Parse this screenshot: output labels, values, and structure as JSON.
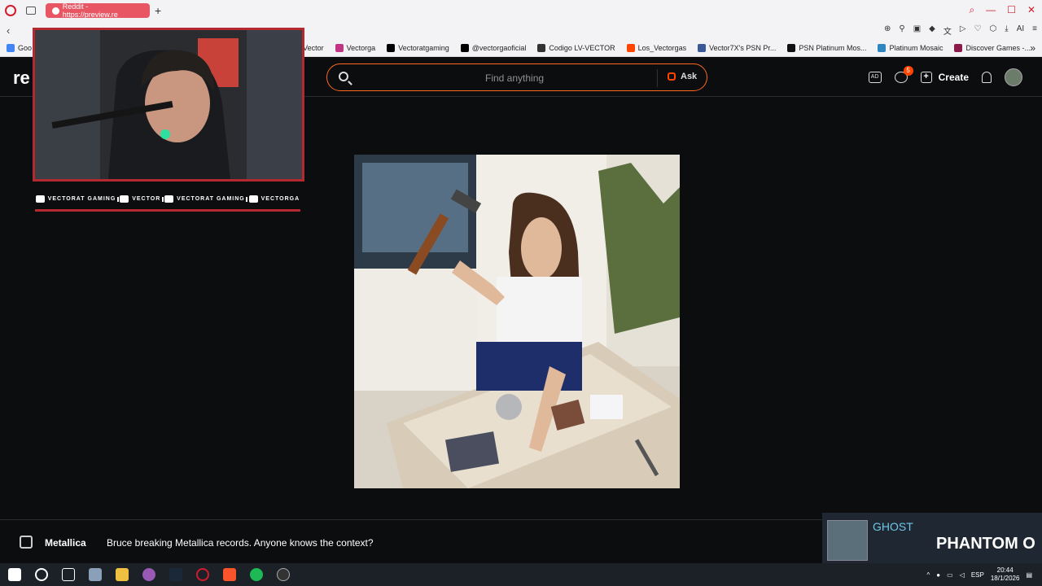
{
  "browser": {
    "tab_title": "Reddit - https://preview.re",
    "bookmarks": [
      {
        "label": "Vector",
        "color": "#8e44ad"
      },
      {
        "label": "Vectorga",
        "color": "#c13584"
      },
      {
        "label": "Vectoratgaming",
        "color": "#000000"
      },
      {
        "label": "@vectorgaoficial",
        "color": "#000000"
      },
      {
        "label": "Codigo LV-VECTOR",
        "color": "#333333"
      },
      {
        "label": "Los_Vectorgas",
        "color": "#ff4500"
      },
      {
        "label": "Vector7X's PSN Pr...",
        "color": "#3b5998"
      },
      {
        "label": "PSN Platinum Mos...",
        "color": "#111111"
      },
      {
        "label": "Platinum Mosaic",
        "color": "#2e86c1"
      },
      {
        "label": "Discover Games -...",
        "color": "#8b1a4a"
      }
    ],
    "bookmark_first": "Goo"
  },
  "reddit": {
    "logo": "re",
    "search_placeholder": "Find anything",
    "ask_label": "Ask",
    "chat_badge": "5",
    "create_label": "Create",
    "ad_label": "AD"
  },
  "overlay": {
    "socials": [
      {
        "label": "VECTORAT GAMING",
        "icon": "youtube-icon"
      },
      {
        "label": "VECTOR",
        "icon": "twitch-icon"
      },
      {
        "label": "VECTORAT GAMING",
        "icon": "twitter-icon"
      },
      {
        "label": "VECTORGA",
        "icon": "instagram-icon"
      }
    ]
  },
  "post": {
    "subreddit": "Metallica",
    "title": "Bruce breaking Metallica records. Anyone knows the context?"
  },
  "now_playing": {
    "artist": "GHOST",
    "song": "PHANTOM O"
  },
  "taskbar": {
    "lang": "ESP",
    "time": "20:44",
    "date": "18/1/2026"
  }
}
